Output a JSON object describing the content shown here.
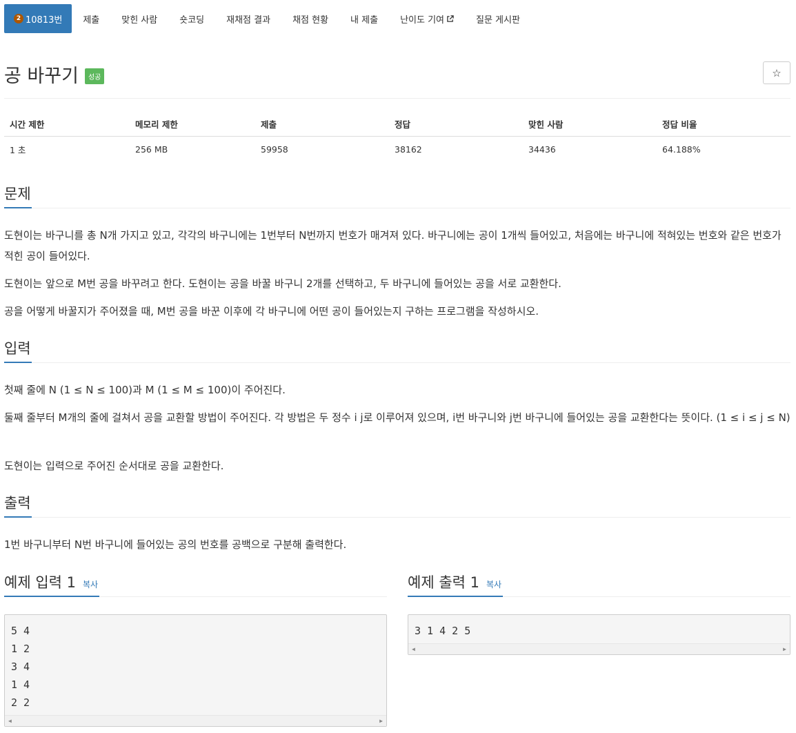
{
  "nav": {
    "tier": "2",
    "problem_tab": "10813번",
    "items": [
      "제출",
      "맞힌 사람",
      "숏코딩",
      "재채점 결과",
      "채점 현황",
      "내 제출",
      "난이도 기여",
      "질문 게시판"
    ],
    "external_icon": "external-link-icon"
  },
  "title": {
    "text": "공 바꾸기",
    "badge": "성공",
    "star": "☆"
  },
  "info": {
    "headers": [
      "시간 제한",
      "메모리 제한",
      "제출",
      "정답",
      "맞힌 사람",
      "정답 비율"
    ],
    "values": [
      "1 초",
      "256 MB",
      "59958",
      "38162",
      "34436",
      "64.188%"
    ]
  },
  "problem": {
    "heading": "문제",
    "paragraphs": [
      "도현이는 바구니를 총 N개 가지고 있고, 각각의 바구니에는 1번부터 N번까지 번호가 매겨져 있다. 바구니에는 공이 1개씩 들어있고, 처음에는 바구니에 적혀있는 번호와 같은 번호가 적힌 공이 들어있다.",
      "도현이는 앞으로 M번 공을 바꾸려고 한다. 도현이는 공을 바꿀 바구니 2개를 선택하고, 두 바구니에 들어있는 공을 서로 교환한다.",
      "공을 어떻게 바꿀지가 주어졌을 때, M번 공을 바꾼 이후에 각 바구니에 어떤 공이 들어있는지 구하는 프로그램을 작성하시오."
    ]
  },
  "input": {
    "heading": "입력",
    "paragraphs": [
      "첫째 줄에 N (1 ≤ N ≤ 100)과 M (1 ≤ M ≤ 100)이 주어진다.",
      "둘째 줄부터 M개의 줄에 걸쳐서 공을 교환할 방법이 주어진다. 각 방법은 두 정수 i j로 이루어져 있으며, i번 바구니와 j번 바구니에 들어있는 공을 교환한다는 뜻이다. (1 ≤ i ≤ j ≤ N)",
      "도현이는 입력으로 주어진 순서대로 공을 교환한다."
    ]
  },
  "output": {
    "heading": "출력",
    "paragraphs": [
      "1번 바구니부터 N번 바구니에 들어있는 공의 번호를 공백으로 구분해 출력한다."
    ]
  },
  "samples": {
    "input_heading": "예제 입력 1",
    "output_heading": "예제 출력 1",
    "copy_label": "복사",
    "input_text": "5 4\n1 2\n3 4\n1 4\n2 2",
    "output_text": "3 1 4 2 5"
  }
}
